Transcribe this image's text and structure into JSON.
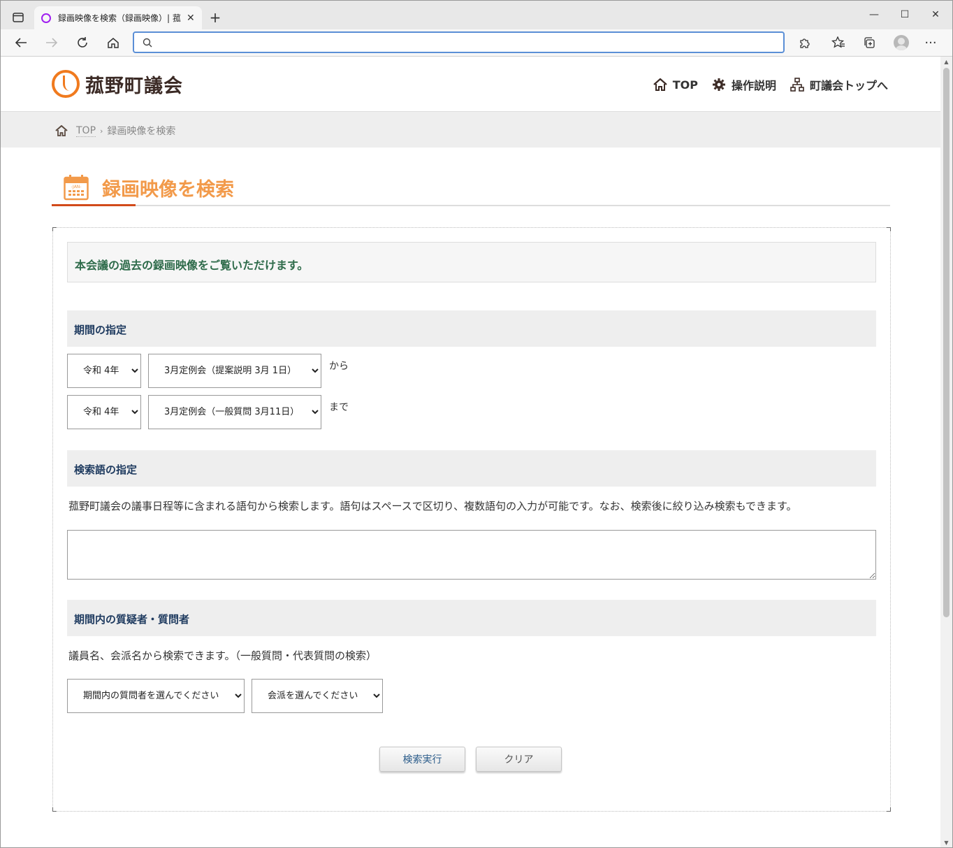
{
  "browser": {
    "tab_title": "録画映像を検索（録画映像）| 菰",
    "address_value": "",
    "accent": "#5b8fd6"
  },
  "site": {
    "logo_text": "菰野町議会",
    "nav": [
      {
        "label": "TOP"
      },
      {
        "label": "操作説明"
      },
      {
        "label": "町議会トップへ"
      }
    ],
    "breadcrumb": {
      "home": "TOP",
      "current": "録画映像を検索"
    }
  },
  "page": {
    "title": "録画映像を検索",
    "intro": "本会議の過去の録画映像をご覧いただけます。",
    "period": {
      "heading": "期間の指定",
      "from": {
        "year": "令和 4年",
        "session": "3月定例会（提案説明 3月 1日）",
        "suffix": "から"
      },
      "to": {
        "year": "令和 4年",
        "session": "3月定例会（一般質問 3月11日）",
        "suffix": "まで"
      }
    },
    "keyword": {
      "heading": "検索語の指定",
      "description": "菰野町議会の議事日程等に含まれる語句から検索します。語句はスペースで区切り、複数語句の入力が可能です。なお、検索後に絞り込み検索もできます。",
      "value": ""
    },
    "questioner": {
      "heading": "期間内の質疑者・質問者",
      "description": "議員名、会派名から検索できます。（一般質問・代表質問の検索）",
      "member_select": "期間内の質問者を選んでください",
      "faction_select": "会派を選んでください"
    },
    "buttons": {
      "search": "検索実行",
      "clear": "クリア"
    }
  },
  "colors": {
    "title_orange": "#f29a4a",
    "accent_red": "#d24a1a",
    "intro_green": "#2e6b4a",
    "heading_navy": "#1e3a5f"
  }
}
